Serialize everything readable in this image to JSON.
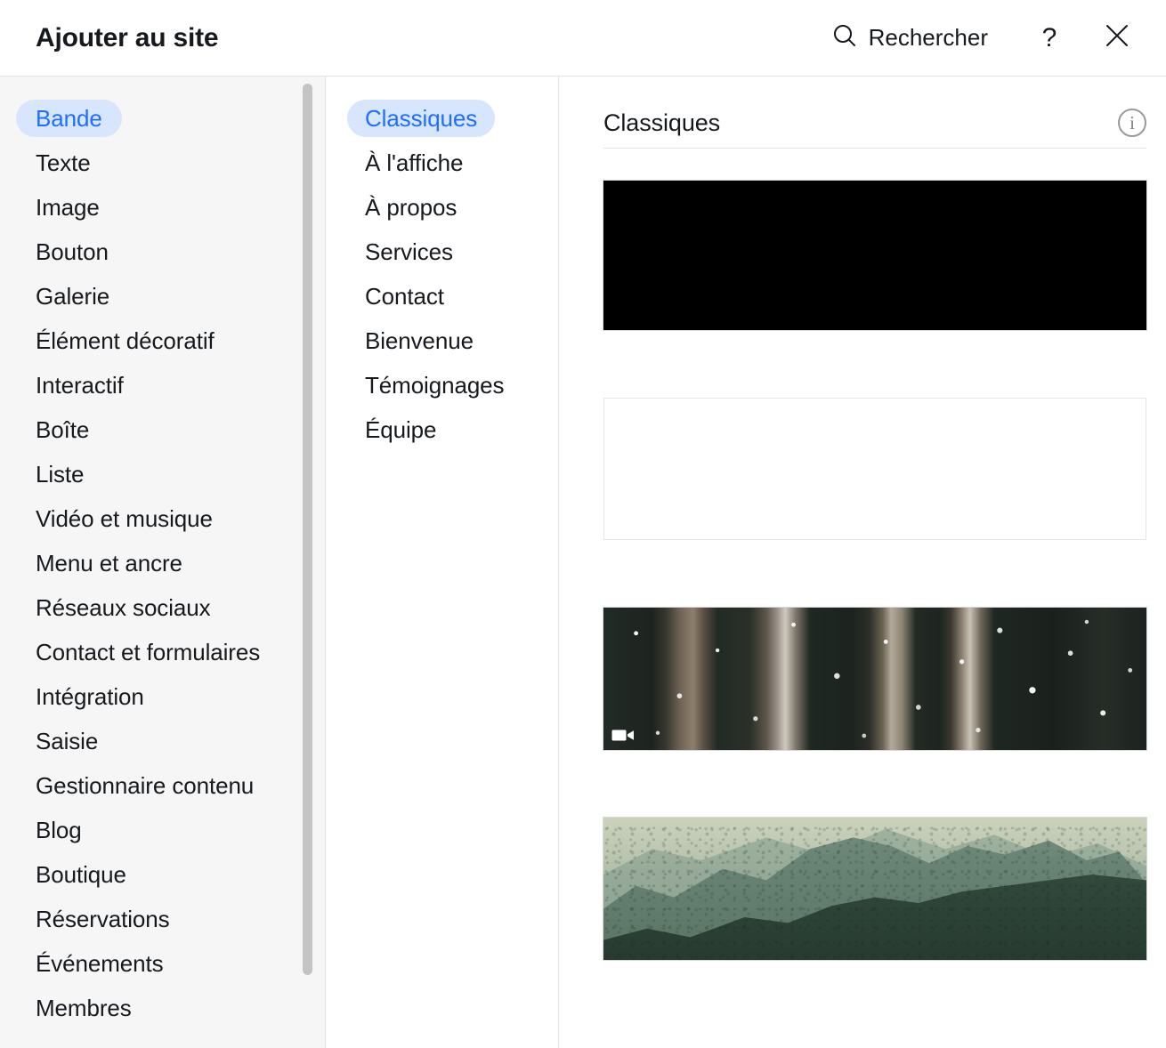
{
  "header": {
    "title": "Ajouter au site",
    "search_label": "Rechercher",
    "search_icon": "search-icon",
    "help_label": "?",
    "help_icon": "help-question-icon",
    "close_icon": "close-x-icon"
  },
  "sidebar": {
    "selected": "Bande",
    "items": [
      {
        "label": "Bande",
        "selected": true
      },
      {
        "label": "Texte",
        "selected": false
      },
      {
        "label": "Image",
        "selected": false
      },
      {
        "label": "Bouton",
        "selected": false
      },
      {
        "label": "Galerie",
        "selected": false
      },
      {
        "label": "Élément décoratif",
        "selected": false
      },
      {
        "label": "Interactif",
        "selected": false
      },
      {
        "label": "Boîte",
        "selected": false
      },
      {
        "label": "Liste",
        "selected": false
      },
      {
        "label": "Vidéo et musique",
        "selected": false
      },
      {
        "label": "Menu et ancre",
        "selected": false
      },
      {
        "label": "Réseaux sociaux",
        "selected": false
      },
      {
        "label": "Contact et formulaires",
        "selected": false
      },
      {
        "label": "Intégration",
        "selected": false
      },
      {
        "label": "Saisie",
        "selected": false
      },
      {
        "label": "Gestionnaire contenu",
        "selected": false
      },
      {
        "label": "Blog",
        "selected": false
      },
      {
        "label": "Boutique",
        "selected": false
      },
      {
        "label": "Réservations",
        "selected": false
      },
      {
        "label": "Événements",
        "selected": false
      },
      {
        "label": "Membres",
        "selected": false
      }
    ]
  },
  "sections": {
    "selected": "Classiques",
    "items": [
      {
        "label": "Classiques",
        "selected": true
      },
      {
        "label": "À l'affiche",
        "selected": false
      },
      {
        "label": "À propos",
        "selected": false
      },
      {
        "label": "Services",
        "selected": false
      },
      {
        "label": "Contact",
        "selected": false
      },
      {
        "label": "Bienvenue",
        "selected": false
      },
      {
        "label": "Témoignages",
        "selected": false
      },
      {
        "label": "Équipe",
        "selected": false
      }
    ]
  },
  "content": {
    "title": "Classiques",
    "info_icon": "info-circle-icon",
    "info_glyph": "i",
    "thumbnails": [
      {
        "kind": "black",
        "badge": null
      },
      {
        "kind": "blank",
        "badge": null
      },
      {
        "kind": "snow",
        "badge": "video-camera-icon"
      },
      {
        "kind": "mountain",
        "badge": null
      }
    ]
  },
  "colors": {
    "accent_blue": "#1f6ffd",
    "accent_pill_bg": "#d7e5fd",
    "sidebar_bg": "#f6f6f6",
    "text_primary": "#16191d",
    "border": "#e3e3e3",
    "scrollbar_thumb": "#c4c4c4"
  }
}
